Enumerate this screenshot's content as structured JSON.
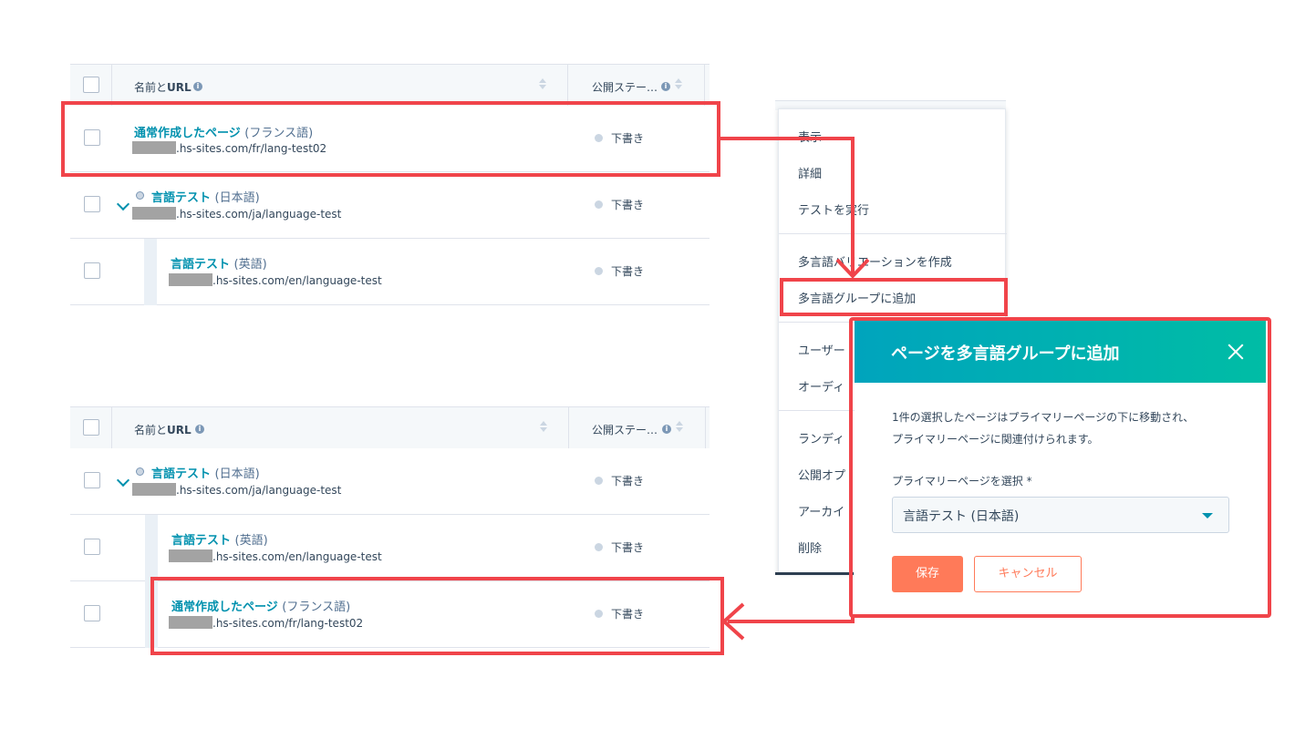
{
  "table": {
    "header_name": "名前と",
    "header_url": "URL",
    "header_status": "公開ステー…"
  },
  "top_table_rows": [
    {
      "title": "通常作成したページ",
      "lang": "(フランス語)",
      "url": ".hs-sites.com/fr/lang-test02",
      "status": "下書き"
    },
    {
      "title": "言語テスト",
      "lang": "(日本語)",
      "url": ".hs-sites.com/ja/language-test",
      "status": "下書き"
    },
    {
      "title": "言語テスト",
      "lang": "(英語)",
      "url": ".hs-sites.com/en/language-test",
      "status": "下書き"
    }
  ],
  "bottom_table_rows": [
    {
      "title": "言語テスト",
      "lang": "(日本語)",
      "url": ".hs-sites.com/ja/language-test",
      "status": "下書き"
    },
    {
      "title": "言語テスト",
      "lang": "(英語)",
      "url": ".hs-sites.com/en/language-test",
      "status": "下書き"
    },
    {
      "title": "通常作成したページ",
      "lang": "(フランス語)",
      "url": ".hs-sites.com/fr/lang-test02",
      "status": "下書き"
    }
  ],
  "menu": {
    "items": [
      "表示",
      "詳細",
      "テストを実行",
      "多言語バリエーションを作成",
      "多言語グループに追加",
      "ユーザー",
      "オーディ",
      "ランディ",
      "公開オプ",
      "アーカイ",
      "削除"
    ]
  },
  "dialog": {
    "title": "ページを多言語グループに追加",
    "body": "1件の選択したページはプライマリーページの下に移動され、プライマリーページに関連付けられます。",
    "select_label": "プライマリーページを選択 *",
    "select_value": "言語テスト (日本語)",
    "save_label": "保存",
    "cancel_label": "キャンセル"
  },
  "colors": {
    "accent": "#0091ae",
    "highlight": "#f0444a",
    "primary_button": "#ff7a59",
    "header_gradient_start": "#00a4bd",
    "header_gradient_end": "#00bda5"
  }
}
